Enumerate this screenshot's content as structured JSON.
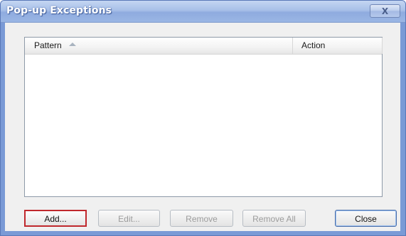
{
  "window": {
    "title": "Pop-up Exceptions",
    "close_glyph": "X"
  },
  "list": {
    "columns": [
      {
        "label": "Pattern",
        "sorted": "ascending"
      },
      {
        "label": "Action"
      }
    ],
    "rows": []
  },
  "buttons": {
    "add": "Add...",
    "edit": "Edit...",
    "remove": "Remove",
    "remove_all": "Remove All",
    "close": "Close"
  },
  "colors": {
    "highlight": "#c0282d",
    "titlebar": "#9ab6e4"
  }
}
